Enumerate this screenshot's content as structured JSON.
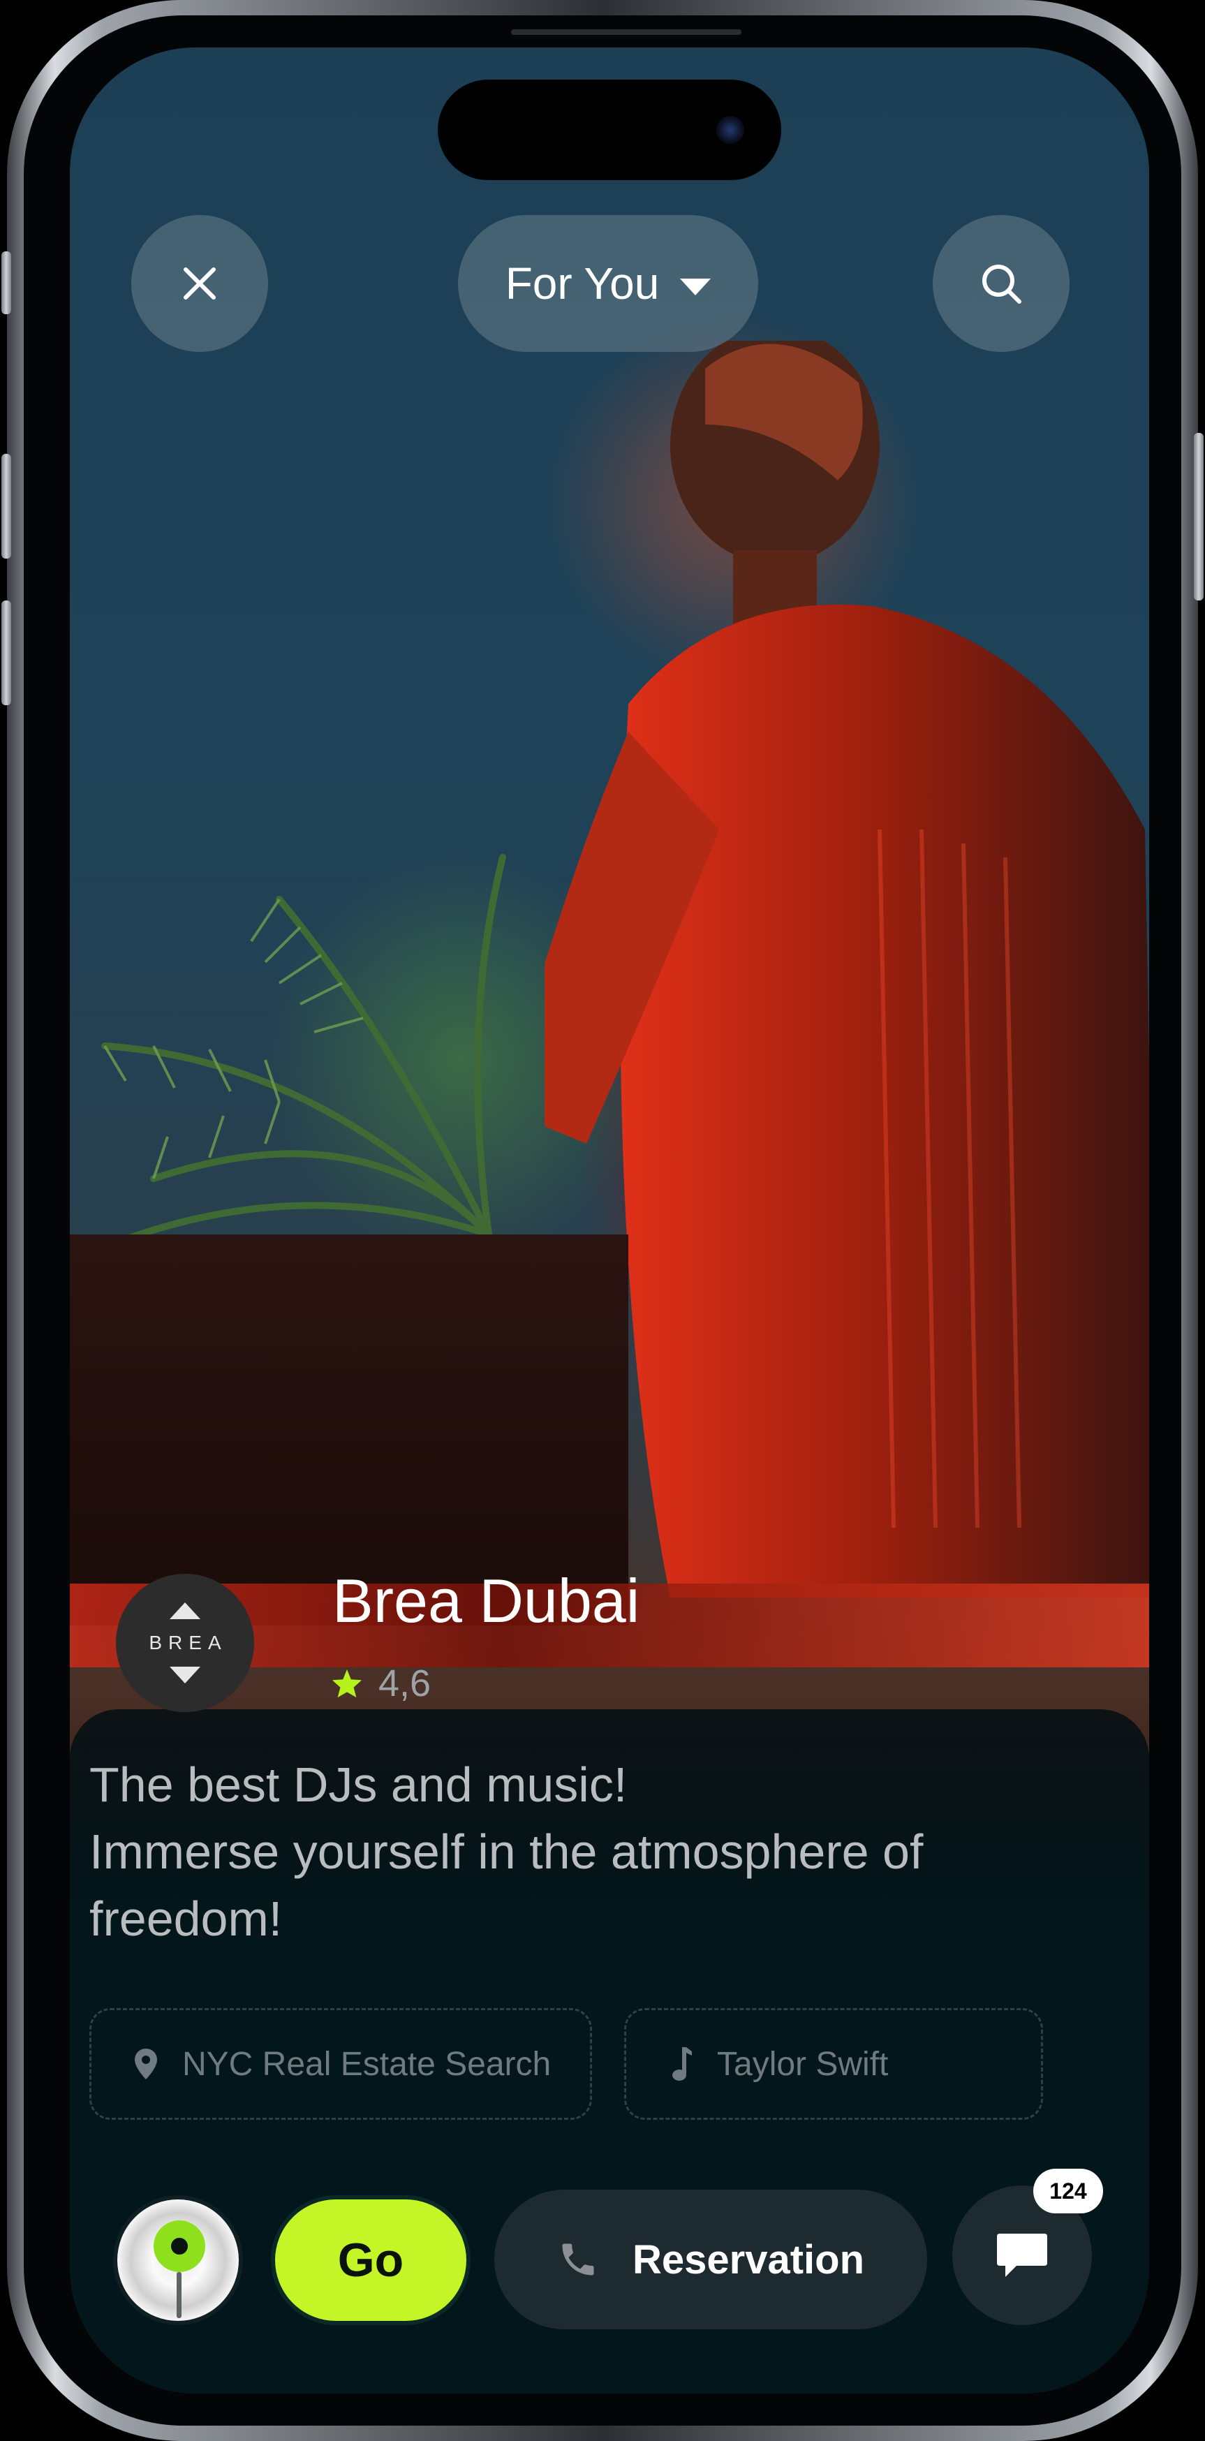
{
  "header": {
    "close_icon": "close-icon",
    "feed_selector_label": "For You",
    "search_icon": "search-icon"
  },
  "venue": {
    "logo_text": "BREA",
    "name": "Brea Dubai",
    "rating": "4,6",
    "rating_color": "#b6f21b",
    "description_lines": [
      "The best DJs and music!",
      "Immerse yourself in the atmosphere of",
      "freedom!"
    ]
  },
  "chips": {
    "location": "NYC Real Estate Search",
    "music": "Taylor Swift"
  },
  "actions": {
    "go_label": "Go",
    "reservation_label": "Reservation",
    "messages_count": "124",
    "accent_color": "#c4f627"
  }
}
